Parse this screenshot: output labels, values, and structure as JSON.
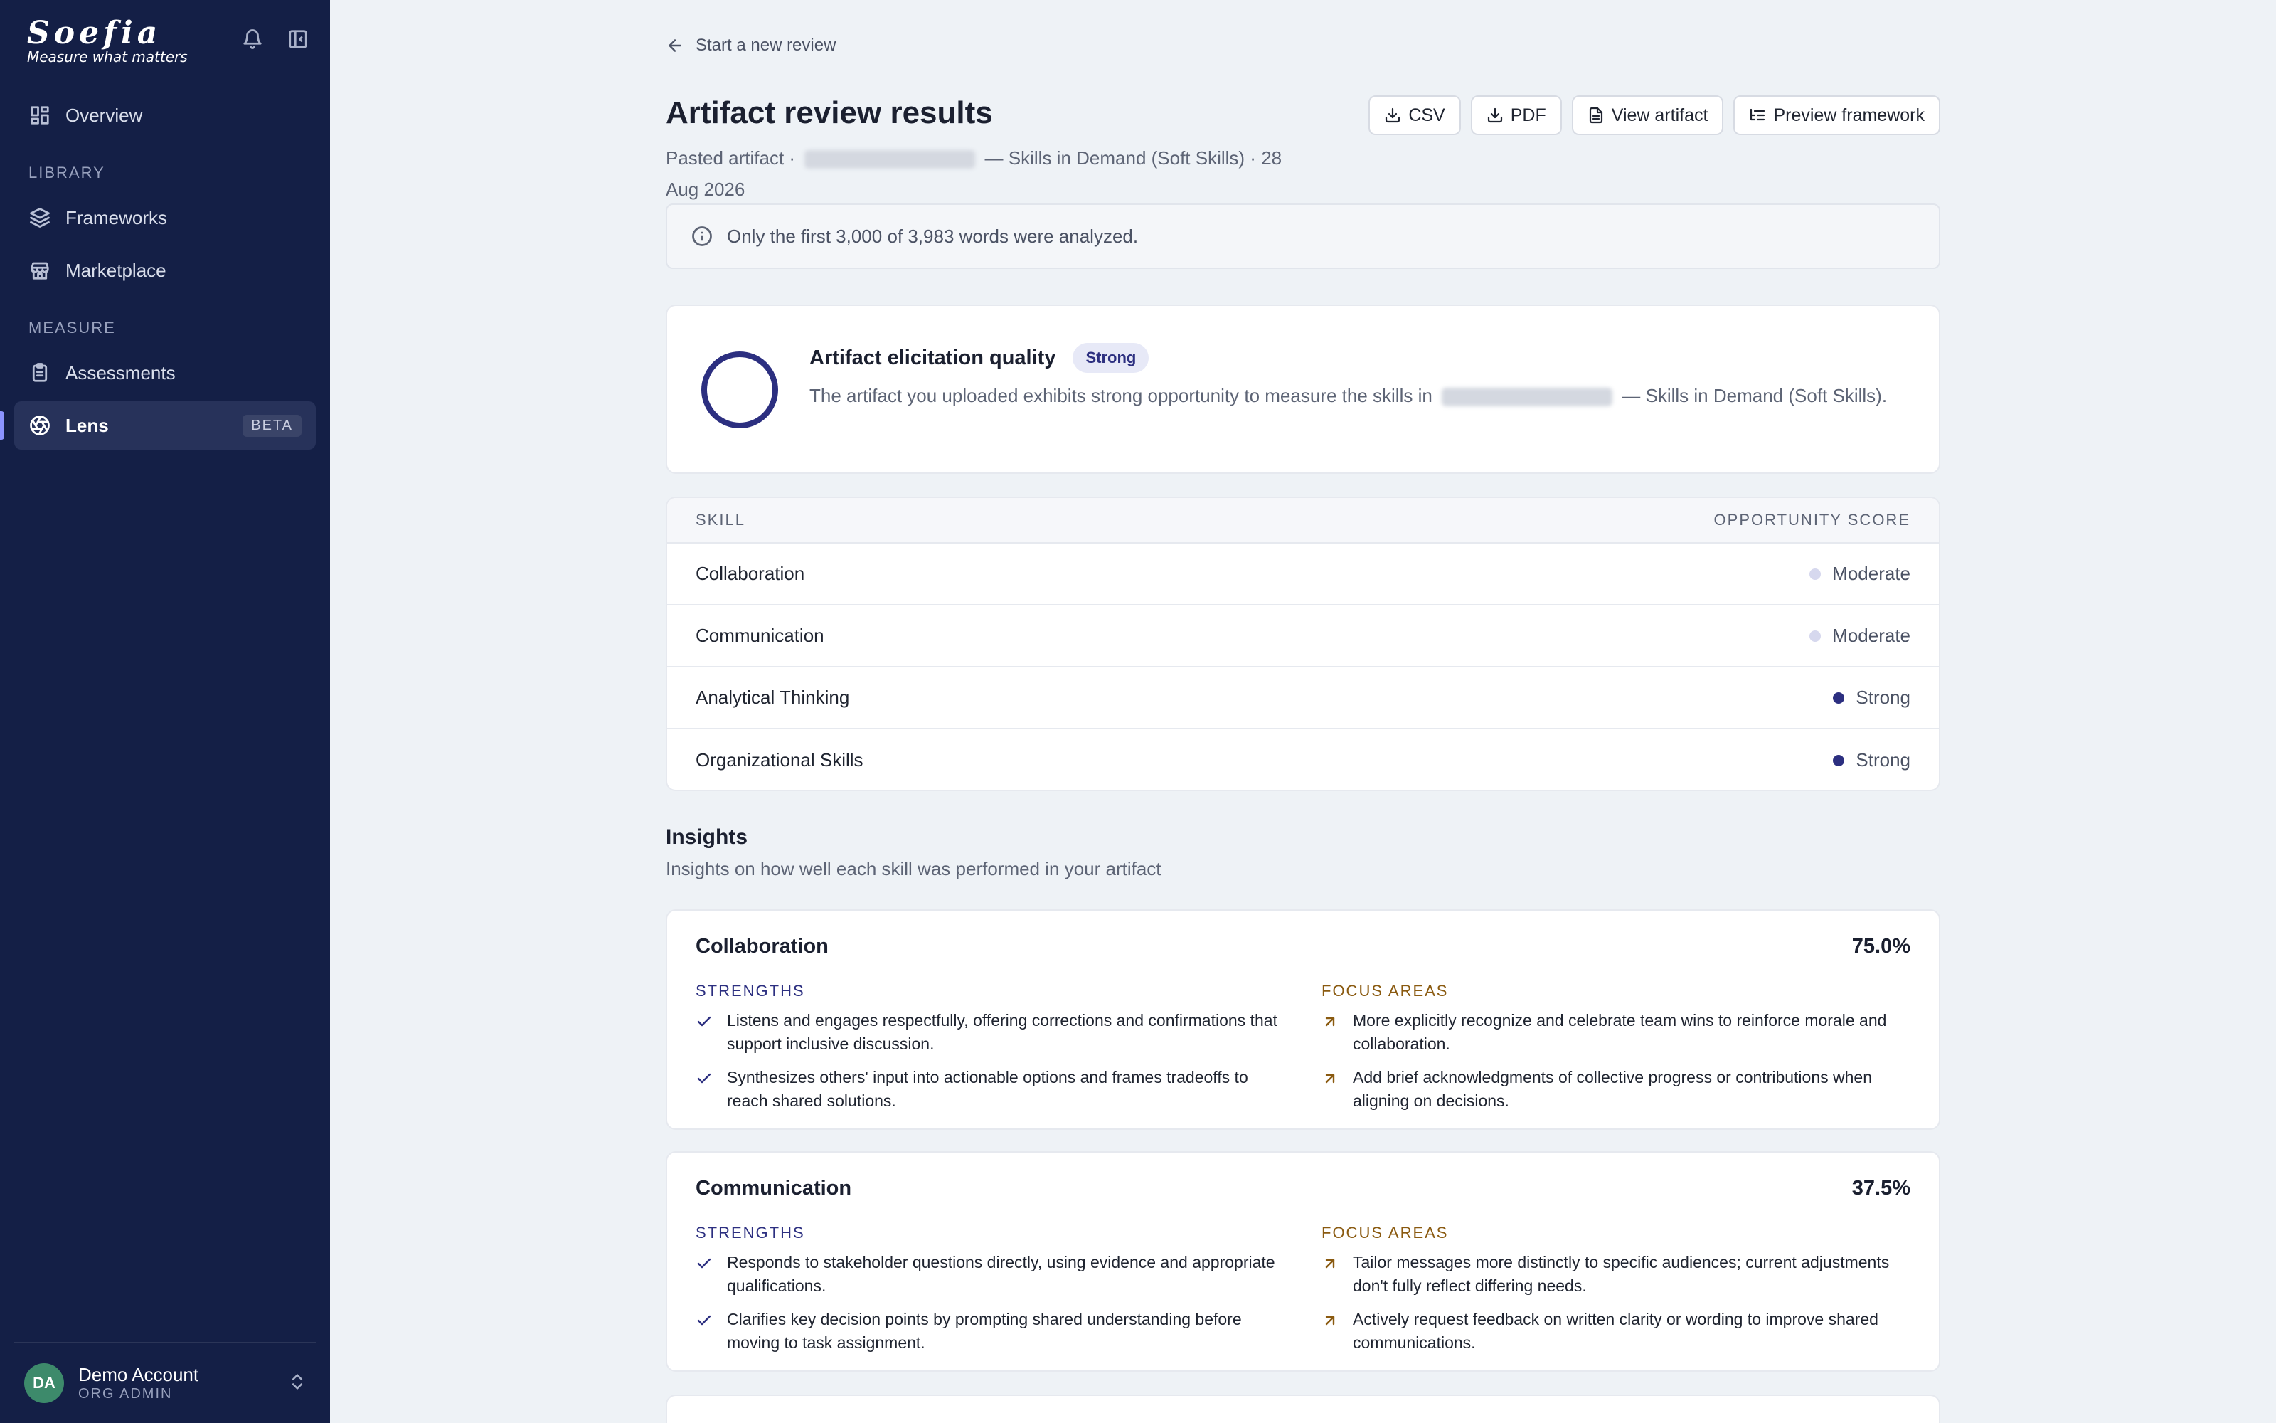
{
  "brand": {
    "logo": "Soefia",
    "tagline": "Measure what matters"
  },
  "sidebar": {
    "overview": "Overview",
    "library_label": "LIBRARY",
    "frameworks": "Frameworks",
    "marketplace": "Marketplace",
    "measure_label": "MEASURE",
    "assessments": "Assessments",
    "lens": "Lens",
    "lens_badge": "BETA",
    "account": {
      "initials": "DA",
      "name": "Demo Account",
      "role": "ORG ADMIN"
    }
  },
  "header": {
    "back": "Start a new review",
    "title": "Artifact review results",
    "subtitle_prefix": "Pasted artifact ·",
    "subtitle_suffix": "— Skills in Demand (Soft Skills) · 28 Aug 2026",
    "buttons": {
      "csv": "CSV",
      "pdf": "PDF",
      "view": "View artifact",
      "preview": "Preview framework"
    }
  },
  "notice": "Only the first 3,000 of 3,983 words were analyzed.",
  "quality": {
    "title": "Artifact elicitation quality",
    "badge": "Strong",
    "desc_prefix": "The artifact you uploaded exhibits strong opportunity to measure the skills in",
    "desc_suffix": "— Skills in Demand (Soft Skills)."
  },
  "skills_table": {
    "col_skill": "SKILL",
    "col_score": "OPPORTUNITY SCORE",
    "rows": [
      {
        "skill": "Collaboration",
        "score": "Moderate",
        "color": "#d6d8ee"
      },
      {
        "skill": "Communication",
        "score": "Moderate",
        "color": "#d6d8ee"
      },
      {
        "skill": "Analytical Thinking",
        "score": "Strong",
        "color": "#2c2f80"
      },
      {
        "skill": "Organizational Skills",
        "score": "Strong",
        "color": "#2c2f80"
      }
    ]
  },
  "insights": {
    "title": "Insights",
    "subtitle": "Insights on how well each skill was performed in your artifact",
    "strengths_label": "STRENGTHS",
    "focus_label": "FOCUS AREAS",
    "cards": [
      {
        "skill": "Collaboration",
        "pct": "75.0%",
        "strengths": [
          "Listens and engages respectfully, offering corrections and confirmations that support inclusive discussion.",
          "Synthesizes others' input into actionable options and frames tradeoffs to reach shared solutions."
        ],
        "focus": [
          "More explicitly recognize and celebrate team wins to reinforce morale and collaboration.",
          "Add brief acknowledgments of collective progress or contributions when aligning on decisions."
        ]
      },
      {
        "skill": "Communication",
        "pct": "37.5%",
        "strengths": [
          "Responds to stakeholder questions directly, using evidence and appropriate qualifications.",
          "Clarifies key decision points by prompting shared understanding before moving to task assignment."
        ],
        "focus": [
          "Tailor messages more distinctly to specific audiences; current adjustments don't fully reflect differing needs.",
          "Actively request feedback on written clarity or wording to improve shared communications."
        ]
      }
    ]
  },
  "colors": {
    "sidebar_bg": "#141f46",
    "accent": "#2c2f80",
    "focus": "#8a5a10",
    "page_bg": "#eef2f6"
  }
}
